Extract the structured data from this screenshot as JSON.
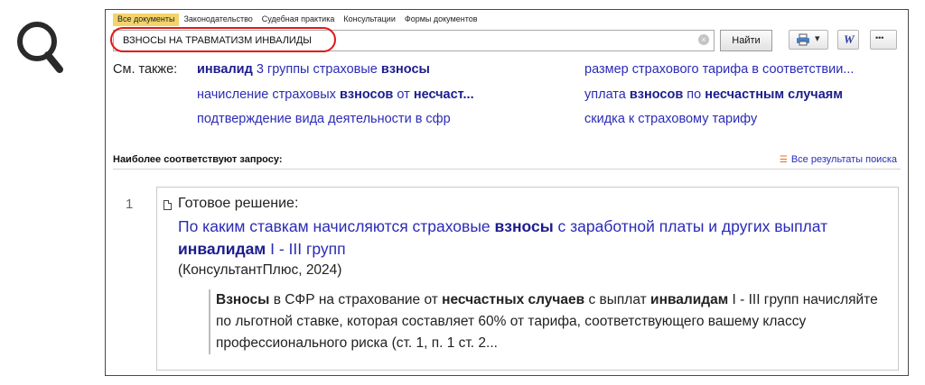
{
  "tabs": [
    "Все документы",
    "Законодательство",
    "Судебная практика",
    "Консультации",
    "Формы документов"
  ],
  "search": {
    "value": "ВЗНОСЫ НА ТРАВМАТИЗМ ИНВАЛИДЫ",
    "clear_glyph": "×",
    "button_label": "Найти"
  },
  "toolbar": {
    "word_label": "W",
    "more_label": "•••",
    "dropdown_glyph": "▾"
  },
  "see_also": {
    "label": "См. также:",
    "left": [
      {
        "b1": "инвалид",
        "t1": " 3 группы страховые ",
        "b2": "взносы",
        "t2": ""
      },
      {
        "b1": "",
        "t1": "начисление страховых ",
        "b2": "взносов",
        "t2": " от ",
        "b3": "несчаст..."
      },
      {
        "b1": "",
        "t1": "подтверждение вида деятельности в сфр",
        "b2": "",
        "t2": ""
      }
    ],
    "right": [
      {
        "t1": "размер страхового тарифа в соответствии..."
      },
      {
        "t1": "уплата ",
        "b1": "взносов",
        "t2": " по ",
        "b2": "несчастным случаям"
      },
      {
        "t1": "скидка к страховому тарифу"
      }
    ]
  },
  "results_header": {
    "most_relevant": "Наиболее соответствуют запросу:",
    "all_results": "Все результаты поиска"
  },
  "result": {
    "number": "1",
    "type": "Готовое решение:",
    "title": {
      "t1": "По каким ставкам начисляются страховые ",
      "b1": "взносы",
      "t2": " с заработной платы и других выплат ",
      "b2": "инвалидам",
      "t3": " I - III групп"
    },
    "source": "(КонсультантПлюс, 2024)",
    "snippet": {
      "b1": "Взносы",
      "t1": " в СФР на страхование от ",
      "b2": "несчастных случаев",
      "t2": " с выплат ",
      "b3": "инвалидам",
      "t3": " I - III групп начисляйте по льготной ставке, которая составляет 60% от тарифа, соответствующего вашему классу профессионального риска (ст. 1, п. 1 ст. 2..."
    }
  },
  "colors": {
    "link": "#2b2bb8",
    "link_bold": "#1c1c8e",
    "highlight": "#e01818",
    "active_tab": "#f3d36a"
  },
  "icons": [
    "magnifier-icon",
    "clear-icon",
    "print-icon",
    "dropdown-icon",
    "word-icon",
    "more-icon",
    "list-icon",
    "document-icon"
  ]
}
